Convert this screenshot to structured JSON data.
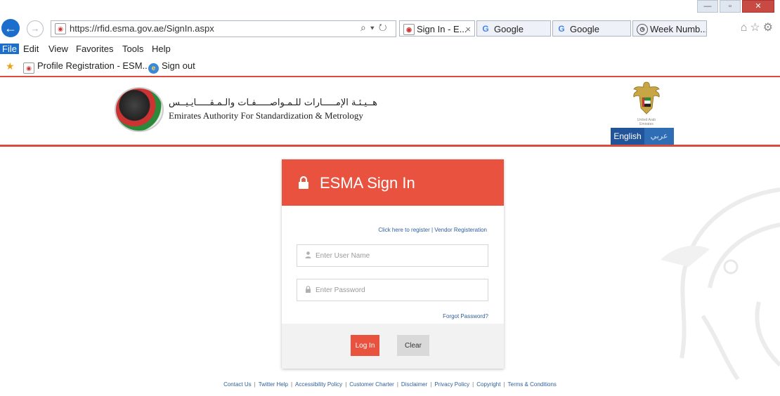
{
  "browser": {
    "url": "https://rfid.esma.gov.ae/SignIn.aspx",
    "tabs": [
      {
        "label": "Sign In - E...",
        "active": true,
        "icon": "site-favicon"
      },
      {
        "label": "Google",
        "active": false,
        "icon": "google-icon"
      },
      {
        "label": "Google",
        "active": false,
        "icon": "google-icon"
      },
      {
        "label": "Week Numb...",
        "active": false,
        "icon": "clock-icon"
      }
    ],
    "tab_close": "×",
    "menu": [
      "File",
      "Edit",
      "View",
      "Favorites",
      "Tools",
      "Help"
    ],
    "favorites": [
      {
        "label": "Profile Registration - ESM...",
        "icon": "site-favicon"
      },
      {
        "label": "Sign out",
        "icon": "ie-icon"
      }
    ]
  },
  "site": {
    "org_name_ar": "هــيـئـة الإمـــــارات للـمـواصـــــفـات والـمـقـــــايـيــس",
    "org_name_en": "Emirates Authority For Standardization & Metrology",
    "emblem_caption": "United Arab Emirates",
    "lang_english": "English",
    "lang_arabic": "عربي"
  },
  "signin": {
    "title": "ESMA Sign In",
    "register_link": "Click here to register",
    "vendor_link": "Vendor Registeration",
    "link_separator": "|",
    "username_placeholder": "Enter User Name",
    "password_placeholder": "Enter Password",
    "forgot_link": "Forgot Password?",
    "login_button": "Log In",
    "clear_button": "Clear"
  },
  "footer": {
    "links": [
      "Contact Us",
      "Twitter Help",
      "Accessibility Policy",
      "Customer Charter",
      "Disclaimer",
      "Privacy Policy",
      "Copyright",
      "Terms & Conditions"
    ],
    "separator": "|"
  },
  "colors": {
    "accent_red": "#e8523f",
    "ie_blue": "#1b6ecb",
    "lang_blue": "#2f6db5",
    "link_blue": "#2f5f9a"
  }
}
